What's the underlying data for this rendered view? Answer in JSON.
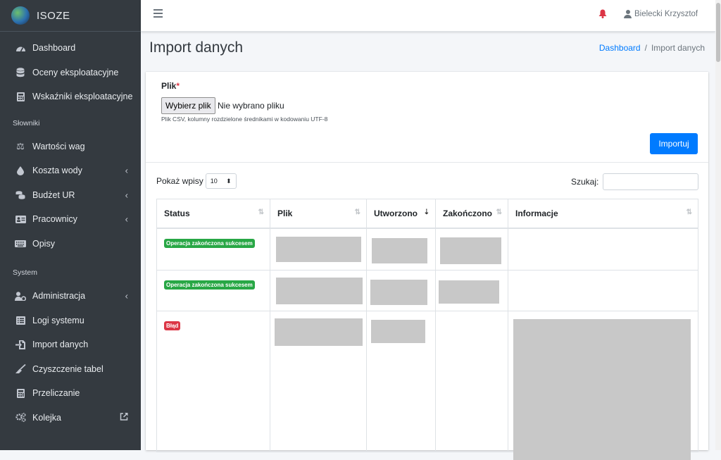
{
  "app": {
    "name": "ISOZE"
  },
  "sidebar": {
    "items_main": [
      {
        "label": "Dashboard",
        "icon": "tachometer-icon"
      },
      {
        "label": "Oceny eksploatacyjne",
        "icon": "database-icon"
      },
      {
        "label": "Wskaźniki eksploatacyjne",
        "icon": "calculator-icon"
      }
    ],
    "header_slowniki": "Słowniki",
    "items_dict": [
      {
        "label": "Wartości wag",
        "icon": "balance-scale-icon"
      },
      {
        "label": "Koszta wody",
        "icon": "water-drop-icon"
      },
      {
        "label": "Budżet UR",
        "icon": "coins-icon"
      },
      {
        "label": "Pracownicy",
        "icon": "id-card-icon"
      },
      {
        "label": "Opisy",
        "icon": "keyboard-icon"
      }
    ],
    "header_system": "System",
    "items_system": [
      {
        "label": "Administracja",
        "icon": "user-cog-icon"
      },
      {
        "label": "Logi systemu",
        "icon": "list-icon"
      },
      {
        "label": "Import danych",
        "icon": "file-import-icon"
      },
      {
        "label": "Czyszczenie tabel",
        "icon": "broom-icon"
      },
      {
        "label": "Przeliczanie",
        "icon": "calculator-icon"
      },
      {
        "label": "Kolejka",
        "icon": "cogs-icon"
      }
    ]
  },
  "topbar": {
    "user": "Bielecki Krzysztof"
  },
  "page": {
    "title": "Import danych",
    "breadcrumb": {
      "link": "Dashboard",
      "sep": "/",
      "current": "Import danych"
    }
  },
  "upload": {
    "label": "Plik",
    "required": "*",
    "button": "Wybierz plik",
    "no_file": "Nie wybrano pliku",
    "help": "Plik CSV, kolumny rozdzielone średnikami w kodowaniu UTF-8",
    "submit": "Importuj"
  },
  "table_controls": {
    "show_label": "Pokaż wpisy",
    "page_size": "10",
    "search_label": "Szukaj:"
  },
  "table": {
    "headers": [
      "Status",
      "Plik",
      "Utworzono",
      "Zakończono",
      "Informacje"
    ],
    "sorted_column": "Utworzono",
    "rows": [
      {
        "status": "Operacja zakończona sukcesem",
        "status_type": "success"
      },
      {
        "status": "Operacja zakończona sukcesem",
        "status_type": "success"
      },
      {
        "status": "Błąd",
        "status_type": "error"
      }
    ]
  },
  "colors": {
    "primary": "#007bff",
    "success": "#28a745",
    "danger": "#dc3545",
    "sidebar": "#343a40"
  }
}
